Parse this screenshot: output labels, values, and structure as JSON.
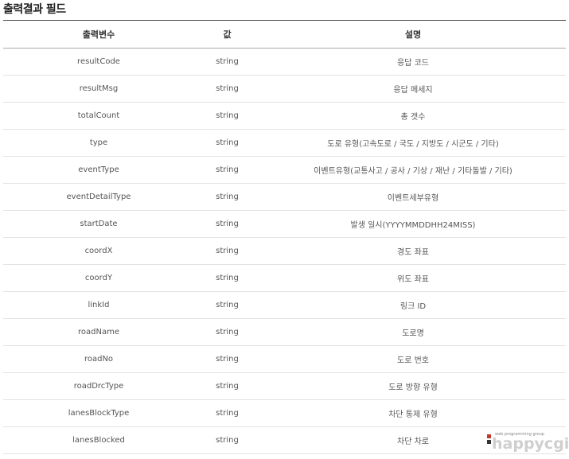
{
  "section_title": "출력결과 필드",
  "table": {
    "headers": [
      "출력변수",
      "값",
      "설명"
    ],
    "rows": [
      {
        "name": "resultCode",
        "value": "string",
        "desc": "응답 코드"
      },
      {
        "name": "resultMsg",
        "value": "string",
        "desc": "응답 메세지"
      },
      {
        "name": "totalCount",
        "value": "string",
        "desc": "총 갯수"
      },
      {
        "name": "type",
        "value": "string",
        "desc": "도로 유형(고속도로 / 국도 / 지방도 / 시군도 / 기타)"
      },
      {
        "name": "eventType",
        "value": "string",
        "desc": "이벤트유형(교통사고 / 공사 / 기상 / 재난 / 기타돌발 / 기타)"
      },
      {
        "name": "eventDetailType",
        "value": "string",
        "desc": "이벤트세부유형"
      },
      {
        "name": "startDate",
        "value": "string",
        "desc": "발생 일시(YYYYMMDDHH24MISS)"
      },
      {
        "name": "coordX",
        "value": "string",
        "desc": "경도 좌표"
      },
      {
        "name": "coordY",
        "value": "string",
        "desc": "위도 좌표"
      },
      {
        "name": "linkId",
        "value": "string",
        "desc": "링크 ID"
      },
      {
        "name": "roadName",
        "value": "string",
        "desc": "도로명"
      },
      {
        "name": "roadNo",
        "value": "string",
        "desc": "도로 번호"
      },
      {
        "name": "roadDrcType",
        "value": "string",
        "desc": "도로 방향 유형"
      },
      {
        "name": "lanesBlockType",
        "value": "string",
        "desc": "차단 통제 유형"
      },
      {
        "name": "lanesBlocked",
        "value": "string",
        "desc": "차단 차로"
      }
    ]
  },
  "watermark": {
    "tagline": "web programming group",
    "logo_text": "happycgi",
    "accent_color": "#c0392b"
  }
}
